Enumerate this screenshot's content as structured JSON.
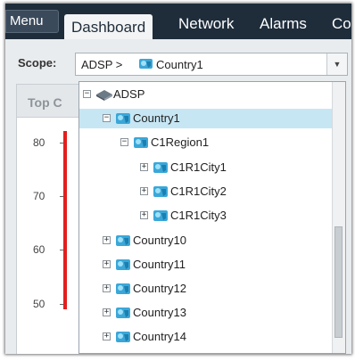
{
  "topbar": {
    "menu_label": "Menu",
    "tabs": [
      {
        "label": "Dashboard",
        "active": true
      },
      {
        "label": "Network",
        "active": false
      },
      {
        "label": "Alarms",
        "active": false
      },
      {
        "label": "Co",
        "active": false
      }
    ]
  },
  "scope": {
    "label": "Scope:",
    "path": "ADSP >",
    "selected": "Country1"
  },
  "panel": {
    "title": "Top C",
    "y_ticks": [
      "80",
      "70",
      "60",
      "50"
    ]
  },
  "tree": {
    "root": "ADSP",
    "nodes": [
      {
        "label": "Country1",
        "expanded": true,
        "selected": true
      },
      {
        "label": "C1Region1",
        "expanded": true
      },
      {
        "label": "C1R1City1",
        "expanded": false
      },
      {
        "label": "C1R1City2",
        "expanded": false
      },
      {
        "label": "C1R1City3",
        "expanded": false
      },
      {
        "label": "Country10",
        "expanded": false
      },
      {
        "label": "Country11",
        "expanded": false
      },
      {
        "label": "Country12",
        "expanded": false
      },
      {
        "label": "Country13",
        "expanded": false
      },
      {
        "label": "Country14",
        "expanded": false
      }
    ]
  },
  "colors": {
    "topbar": "#1f2d3b",
    "selection": "#c7e6f4",
    "chart_line": "#e41e1e",
    "node_icon": "#3aa7d8"
  },
  "icons": [
    "globe-icon",
    "country-icon",
    "chevron-down-icon"
  ]
}
